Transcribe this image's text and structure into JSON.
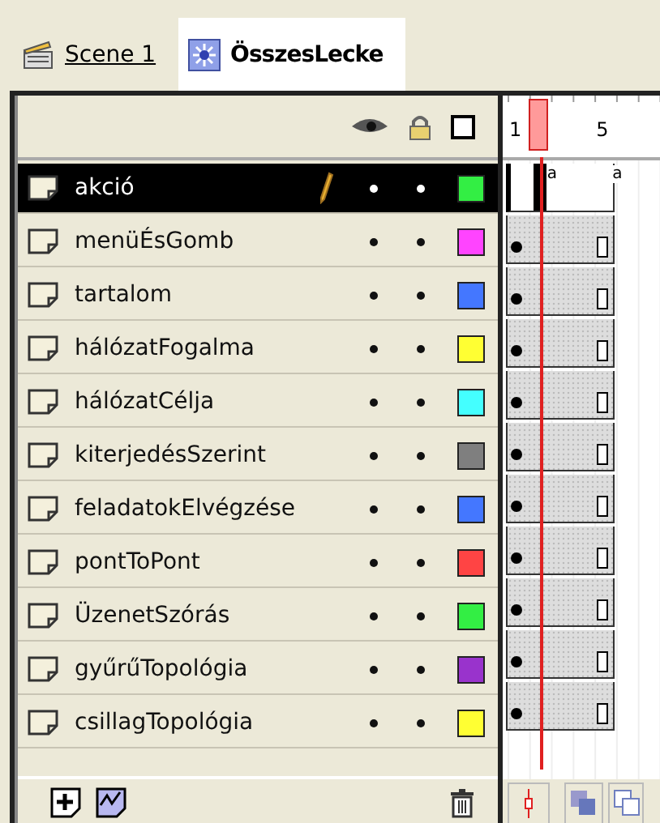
{
  "tabs": [
    {
      "kind": "scene",
      "label": "Scene 1",
      "selected": false
    },
    {
      "kind": "symbol",
      "label": "ÖsszesLecke",
      "selected": true
    }
  ],
  "frame_numbers": [
    "1",
    "5"
  ],
  "layers": [
    {
      "name": "akció",
      "selected": true,
      "editing": true,
      "color": "#33ee44",
      "action_marks": [
        "a",
        "a"
      ]
    },
    {
      "name": "menüÉsGomb",
      "selected": false,
      "editing": false,
      "color": "#ff44ff"
    },
    {
      "name": "tartalom",
      "selected": false,
      "editing": false,
      "color": "#4477ff"
    },
    {
      "name": "hálózatFogalma",
      "selected": false,
      "editing": false,
      "color": "#ffff33"
    },
    {
      "name": "hálózatCélja",
      "selected": false,
      "editing": false,
      "color": "#44ffff"
    },
    {
      "name": "kiterjedésSzerint",
      "selected": false,
      "editing": false,
      "color": "#7f7f7f"
    },
    {
      "name": "feladatokElvégzése",
      "selected": false,
      "editing": false,
      "color": "#4477ff"
    },
    {
      "name": "pontToPont",
      "selected": false,
      "editing": false,
      "color": "#ff4444"
    },
    {
      "name": "ÜzenetSzórás",
      "selected": false,
      "editing": false,
      "color": "#33ee44"
    },
    {
      "name": "gyűrűTopológia",
      "selected": false,
      "editing": false,
      "color": "#9933cc"
    },
    {
      "name": "csillagTopológia",
      "selected": false,
      "editing": false,
      "color": "#ffff33"
    }
  ]
}
